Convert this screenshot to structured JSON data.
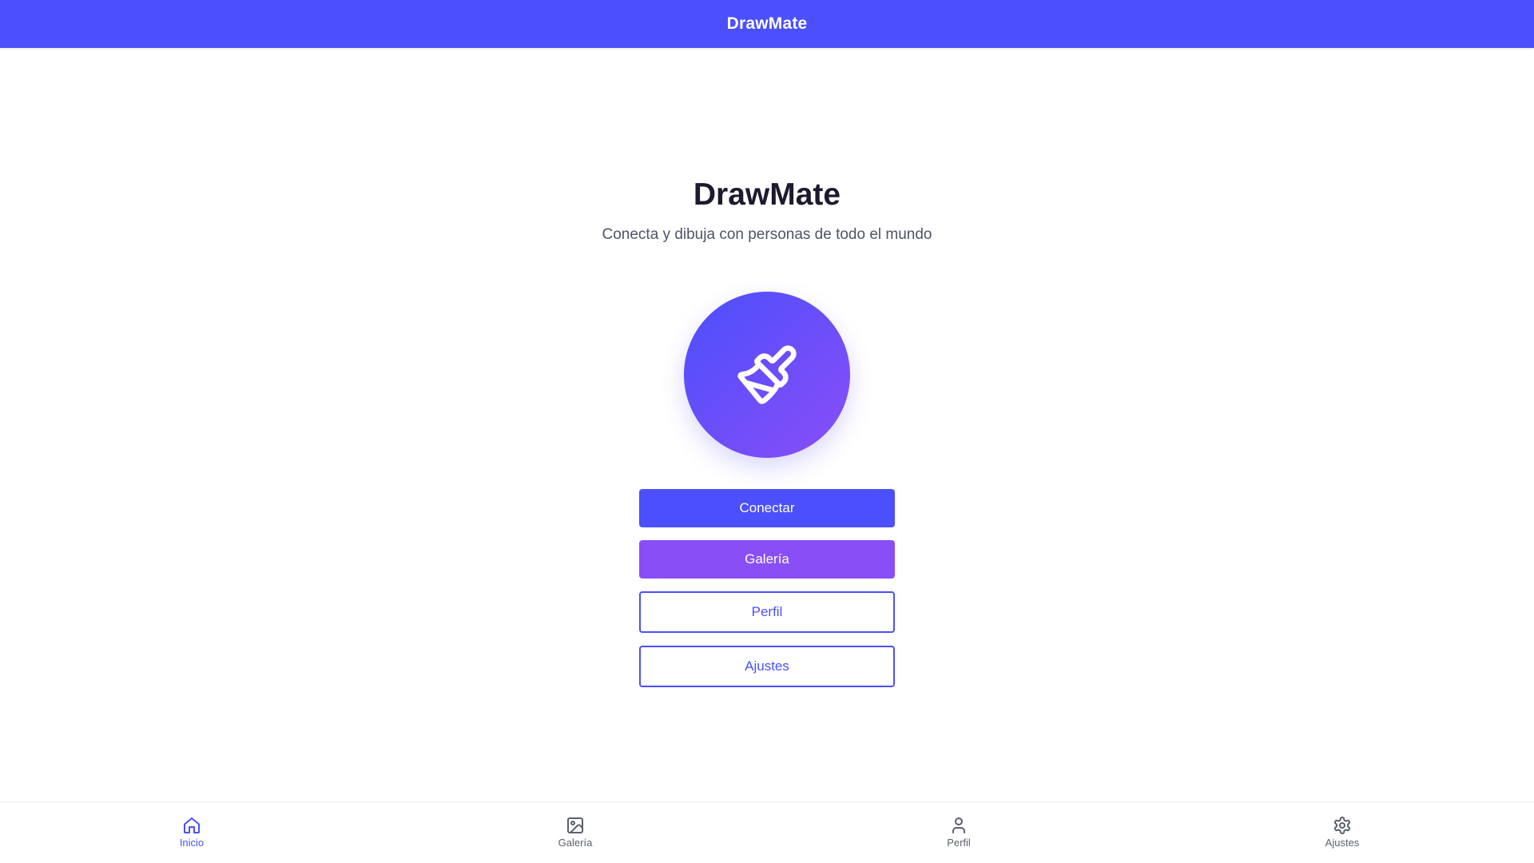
{
  "app": {
    "title": "DrawMate"
  },
  "hero": {
    "title": "DrawMate",
    "subtitle": "Conecta y dibuja con personas de todo el mundo",
    "logo_icon": "paintbrush-icon"
  },
  "actions": {
    "connect_label": "Conectar",
    "gallery_label": "Galería",
    "profile_label": "Perfil",
    "settings_label": "Ajustes"
  },
  "bottom_nav": {
    "active": "Inicio",
    "items": [
      {
        "label": "Inicio",
        "icon": "home-icon"
      },
      {
        "label": "Galería",
        "icon": "image-icon"
      },
      {
        "label": "Perfil",
        "icon": "user-icon"
      },
      {
        "label": "Ajustes",
        "icon": "gear-icon"
      }
    ]
  },
  "colors": {
    "primary": "#4b4ffc",
    "secondary": "#8a4ef7",
    "text_dark": "#1c1b2e",
    "text_muted": "#505366"
  }
}
